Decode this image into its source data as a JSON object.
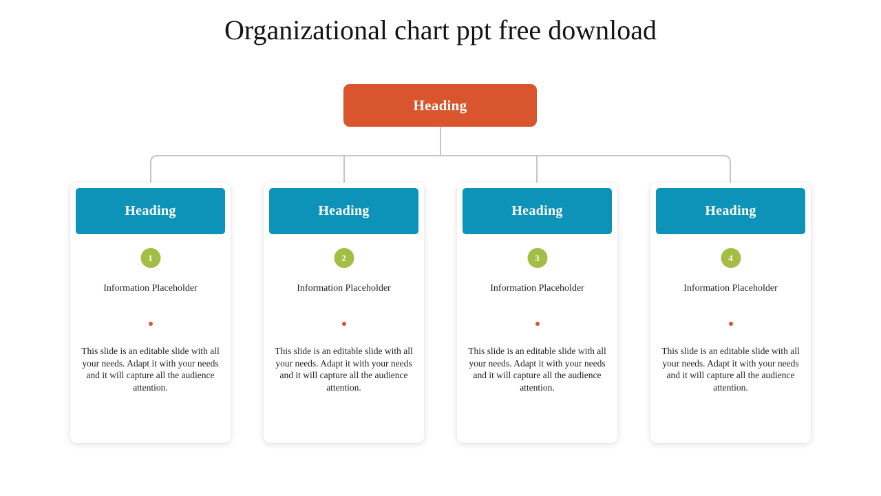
{
  "slide": {
    "title": "Organizational chart ppt free download",
    "background_color": "#ffffff"
  },
  "colors": {
    "root_node": "#d9552e",
    "card_header": "#0d93b8",
    "number_badge": "#a4bd45",
    "bullet_dot": "#d9552e",
    "connector_line": "#c4c6c8",
    "title_text": "#141414",
    "body_text": "#222222"
  },
  "root_node": {
    "label": "Heading"
  },
  "cards": [
    {
      "heading": "Heading",
      "number": "1",
      "info_label": "Information Placeholder",
      "body": "This slide is an editable slide with all your needs. Adapt it with your needs and it will capture all the audience attention."
    },
    {
      "heading": "Heading",
      "number": "2",
      "info_label": "Information Placeholder",
      "body": "This slide is an editable slide with all your needs. Adapt it with your needs and it will capture all the audience attention."
    },
    {
      "heading": "Heading",
      "number": "3",
      "info_label": "Information Placeholder",
      "body": "This slide is an editable slide with all your needs. Adapt it with your needs and it will capture all the audience attention."
    },
    {
      "heading": "Heading",
      "number": "4",
      "info_label": "Information Placeholder",
      "body": "This slide is an editable slide with all your needs. Adapt it with your needs and it will capture all the audience attention."
    }
  ]
}
